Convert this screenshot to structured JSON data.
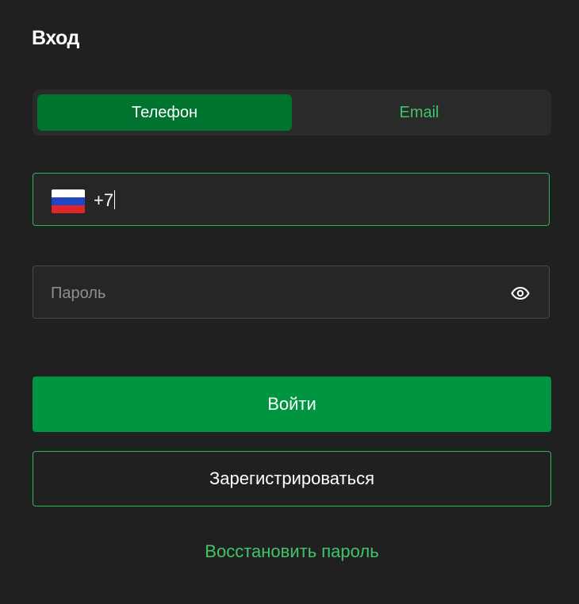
{
  "header": {
    "title": "Вход"
  },
  "tabs": [
    {
      "label": "Телефон",
      "active": true
    },
    {
      "label": "Email",
      "active": false
    }
  ],
  "phone": {
    "country_flag": "russia-flag",
    "value": "+7"
  },
  "password": {
    "placeholder": "Пароль",
    "toggle_icon": "eye-icon"
  },
  "actions": {
    "login_label": "Войти",
    "register_label": "Зарегистрироваться",
    "restore_label": "Восстановить пароль"
  },
  "colors": {
    "background": "#202020",
    "accent": "#009540",
    "accent_dark": "#00732f",
    "accent_text": "#3fc46a"
  }
}
